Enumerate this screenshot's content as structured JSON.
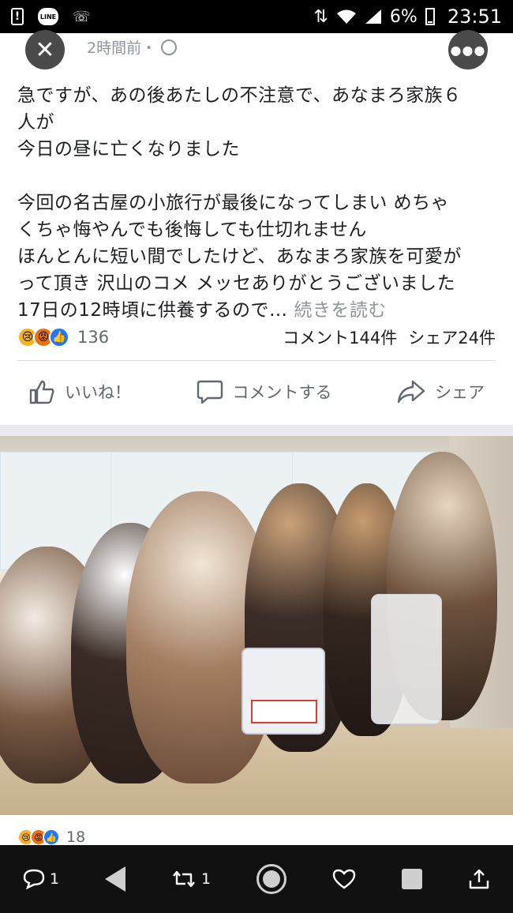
{
  "status_bar": {
    "line_badge": "LINE",
    "battery": "6%",
    "time": "23:51"
  },
  "post": {
    "time": "2時間前・",
    "text_lines_1": [
      "急ですが、あの後あたしの不注意で、あなまろ家族６",
      "人が",
      "今日の昼に亡くなりました"
    ],
    "text_lines_2": [
      "今回の名古屋の小旅行が最後になってしまい めちゃ",
      "くちゃ悔やんでも後悔しても仕切れません",
      "ほんとんに短い間でしたけど、あなまろ家族を可愛が",
      "って頂き 沢山のコメ メッセありがとうございました"
    ],
    "last_line": "17日の12時頃に供養するので…",
    "see_more": "続きを読む",
    "reaction_count": "136",
    "comments": "コメント144件",
    "shares": "シェア24件",
    "photo_reaction_count": "18"
  },
  "actions": {
    "like": "いいね！",
    "comment": "コメントする",
    "share": "シェア"
  },
  "nav": {
    "comment_count": "1",
    "retweet_count": "1"
  },
  "icons": [
    "close-icon",
    "globe-icon",
    "more-icon",
    "like-icon",
    "comment-icon",
    "share-icon",
    "reply-icon",
    "retweet-icon",
    "heart-icon",
    "upload-icon"
  ],
  "colors": {
    "like_blue": "#2078f4",
    "sad_yellow": "#f7b125",
    "angry_orange": "#e9710f",
    "secondary_text": "#606770"
  }
}
